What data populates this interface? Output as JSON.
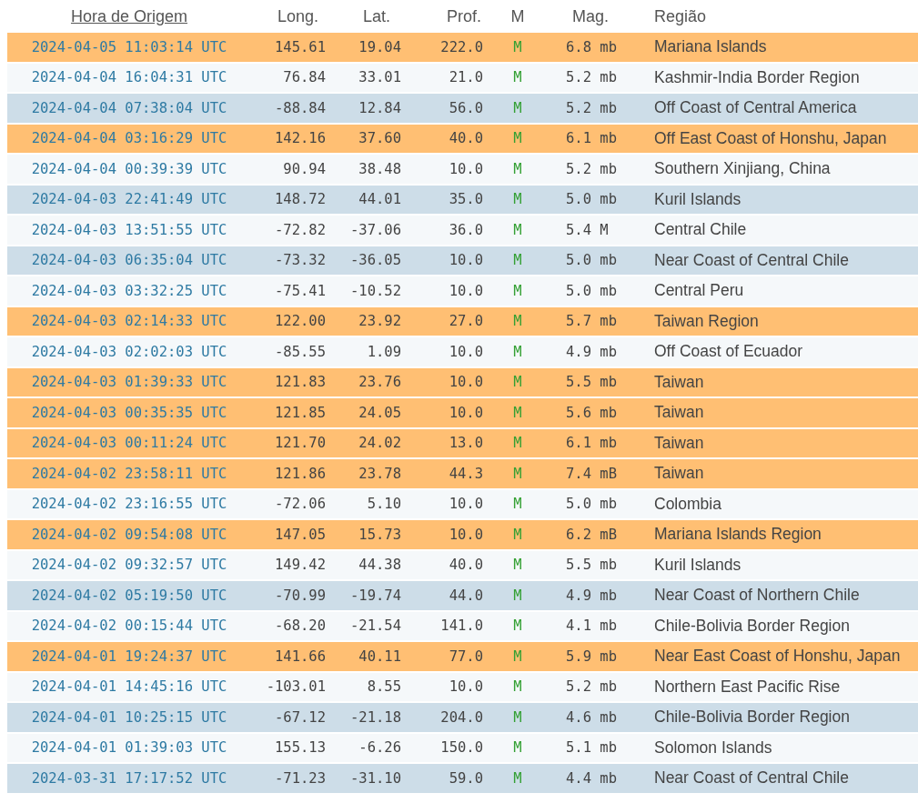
{
  "columns": [
    {
      "label": "Hora de Origem",
      "kind": "link"
    },
    {
      "label": "Long.",
      "kind": "text"
    },
    {
      "label": "Lat.",
      "kind": "text"
    },
    {
      "label": "Prof.",
      "kind": "text"
    },
    {
      "label": "M",
      "kind": "text"
    },
    {
      "label": "Mag.",
      "kind": "text"
    },
    {
      "label": "Região",
      "kind": "text"
    }
  ],
  "rows": [
    {
      "color": "#ffbf73",
      "time": "2024-04-05 11:03:14 UTC",
      "long": "145.61",
      "lat": "19.04",
      "depth": "222.0",
      "m": "M",
      "mag": "6.8 mb",
      "region": "Mariana Islands"
    },
    {
      "color": "#f5f8fa",
      "time": "2024-04-04 16:04:31 UTC",
      "long": "76.84",
      "lat": "33.01",
      "depth": "21.0",
      "m": "M",
      "mag": "5.2 mb",
      "region": "Kashmir-India Border Region"
    },
    {
      "color": "#cddde8",
      "time": "2024-04-04 07:38:04 UTC",
      "long": "-88.84",
      "lat": "12.84",
      "depth": "56.0",
      "m": "M",
      "mag": "5.2 mb",
      "region": "Off Coast of Central America"
    },
    {
      "color": "#ffbf73",
      "time": "2024-04-04 03:16:29 UTC",
      "long": "142.16",
      "lat": "37.60",
      "depth": "40.0",
      "m": "M",
      "mag": "6.1 mb",
      "region": "Off East Coast of Honshu, Japan"
    },
    {
      "color": "#f5f8fa",
      "time": "2024-04-04 00:39:39 UTC",
      "long": "90.94",
      "lat": "38.48",
      "depth": "10.0",
      "m": "M",
      "mag": "5.2 mb",
      "region": "Southern Xinjiang, China"
    },
    {
      "color": "#cddde8",
      "time": "2024-04-03 22:41:49 UTC",
      "long": "148.72",
      "lat": "44.01",
      "depth": "35.0",
      "m": "M",
      "mag": "5.0 mb",
      "region": "Kuril Islands"
    },
    {
      "color": "#f5f8fa",
      "time": "2024-04-03 13:51:55 UTC",
      "long": "-72.82",
      "lat": "-37.06",
      "depth": "36.0",
      "m": "M",
      "mag": "5.4 M",
      "region": "Central Chile"
    },
    {
      "color": "#cddde8",
      "time": "2024-04-03 06:35:04 UTC",
      "long": "-73.32",
      "lat": "-36.05",
      "depth": "10.0",
      "m": "M",
      "mag": "5.0 mb",
      "region": "Near Coast of Central Chile"
    },
    {
      "color": "#f5f8fa",
      "time": "2024-04-03 03:32:25 UTC",
      "long": "-75.41",
      "lat": "-10.52",
      "depth": "10.0",
      "m": "M",
      "mag": "5.0 mb",
      "region": "Central Peru"
    },
    {
      "color": "#ffbf73",
      "time": "2024-04-03 02:14:33 UTC",
      "long": "122.00",
      "lat": "23.92",
      "depth": "27.0",
      "m": "M",
      "mag": "5.7 mb",
      "region": "Taiwan Region"
    },
    {
      "color": "#f5f8fa",
      "time": "2024-04-03 02:02:03 UTC",
      "long": "-85.55",
      "lat": "1.09",
      "depth": "10.0",
      "m": "M",
      "mag": "4.9 mb",
      "region": "Off Coast of Ecuador"
    },
    {
      "color": "#ffbf73",
      "time": "2024-04-03 01:39:33 UTC",
      "long": "121.83",
      "lat": "23.76",
      "depth": "10.0",
      "m": "M",
      "mag": "5.5 mb",
      "region": "Taiwan"
    },
    {
      "color": "#ffbf73",
      "time": "2024-04-03 00:35:35 UTC",
      "long": "121.85",
      "lat": "24.05",
      "depth": "10.0",
      "m": "M",
      "mag": "5.6 mb",
      "region": "Taiwan"
    },
    {
      "color": "#ffbf73",
      "time": "2024-04-03 00:11:24 UTC",
      "long": "121.70",
      "lat": "24.02",
      "depth": "13.0",
      "m": "M",
      "mag": "6.1 mb",
      "region": "Taiwan"
    },
    {
      "color": "#ffbf73",
      "time": "2024-04-02 23:58:11 UTC",
      "long": "121.86",
      "lat": "23.78",
      "depth": "44.3",
      "m": "M",
      "mag": "7.4 mB",
      "region": "Taiwan"
    },
    {
      "color": "#f5f8fa",
      "time": "2024-04-02 23:16:55 UTC",
      "long": "-72.06",
      "lat": "5.10",
      "depth": "10.0",
      "m": "M",
      "mag": "5.0 mb",
      "region": "Colombia"
    },
    {
      "color": "#ffbf73",
      "time": "2024-04-02 09:54:08 UTC",
      "long": "147.05",
      "lat": "15.73",
      "depth": "10.0",
      "m": "M",
      "mag": "6.2 mB",
      "region": "Mariana Islands Region"
    },
    {
      "color": "#f5f8fa",
      "time": "2024-04-02 09:32:57 UTC",
      "long": "149.42",
      "lat": "44.38",
      "depth": "40.0",
      "m": "M",
      "mag": "5.5 mb",
      "region": "Kuril Islands"
    },
    {
      "color": "#cddde8",
      "time": "2024-04-02 05:19:50 UTC",
      "long": "-70.99",
      "lat": "-19.74",
      "depth": "44.0",
      "m": "M",
      "mag": "4.9 mb",
      "region": "Near Coast of Northern Chile"
    },
    {
      "color": "#f5f8fa",
      "time": "2024-04-02 00:15:44 UTC",
      "long": "-68.20",
      "lat": "-21.54",
      "depth": "141.0",
      "m": "M",
      "mag": "4.1 mb",
      "region": "Chile-Bolivia Border Region"
    },
    {
      "color": "#ffbf73",
      "time": "2024-04-01 19:24:37 UTC",
      "long": "141.66",
      "lat": "40.11",
      "depth": "77.0",
      "m": "M",
      "mag": "5.9 mb",
      "region": "Near East Coast of Honshu, Japan"
    },
    {
      "color": "#f5f8fa",
      "time": "2024-04-01 14:45:16 UTC",
      "long": "-103.01",
      "lat": "8.55",
      "depth": "10.0",
      "m": "M",
      "mag": "5.2 mb",
      "region": "Northern East Pacific Rise"
    },
    {
      "color": "#cddde8",
      "time": "2024-04-01 10:25:15 UTC",
      "long": "-67.12",
      "lat": "-21.18",
      "depth": "204.0",
      "m": "M",
      "mag": "4.6 mb",
      "region": "Chile-Bolivia Border Region"
    },
    {
      "color": "#f5f8fa",
      "time": "2024-04-01 01:39:03 UTC",
      "long": "155.13",
      "lat": "-6.26",
      "depth": "150.0",
      "m": "M",
      "mag": "5.1 mb",
      "region": "Solomon Islands"
    },
    {
      "color": "#cddde8",
      "time": "2024-03-31 17:17:52 UTC",
      "long": "-71.23",
      "lat": "-31.10",
      "depth": "59.0",
      "m": "M",
      "mag": "4.4 mb",
      "region": "Near Coast of Central Chile"
    }
  ]
}
